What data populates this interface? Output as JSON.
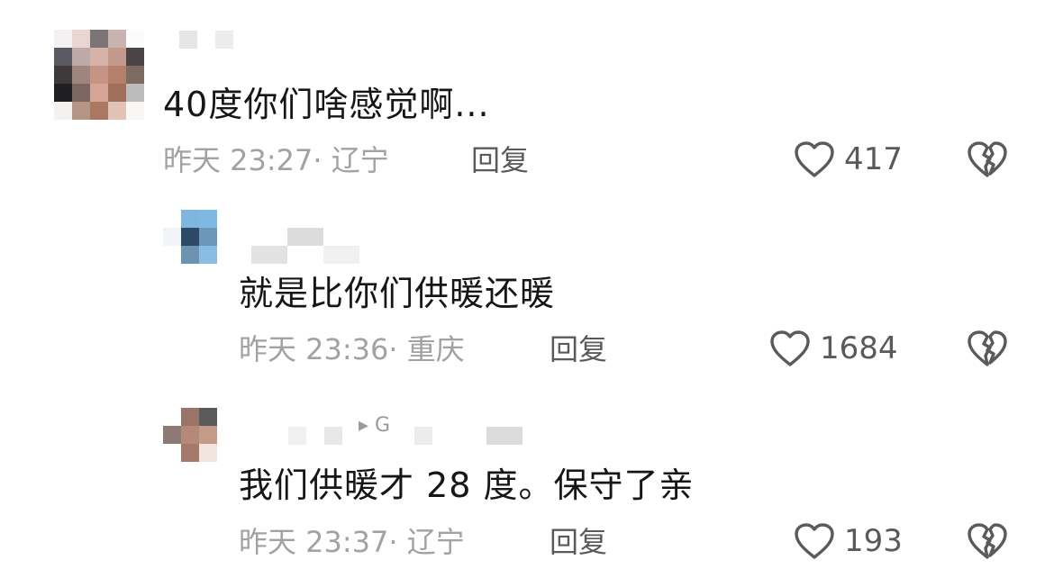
{
  "comments": [
    {
      "text": "40度你们啥感觉啊...",
      "meta": "昨天 23:27· 辽宁",
      "reply": "回复",
      "likes": "417"
    },
    {
      "text": "就是比你们供暖还暖",
      "meta": "昨天 23:36· 重庆",
      "reply": "回复",
      "likes": "1684"
    },
    {
      "text": "我们供暖才 28 度。保守了亲",
      "meta": "昨天 23:37· 辽宁",
      "reply": "回复",
      "likes": "193",
      "username_fragment": "▸ G"
    }
  ],
  "icons": {
    "like": "heart-outline-icon",
    "dislike": "broken-heart-icon"
  },
  "colors": {
    "text": "#161616",
    "meta": "#a2a2a2",
    "action": "#5a5a5a"
  }
}
